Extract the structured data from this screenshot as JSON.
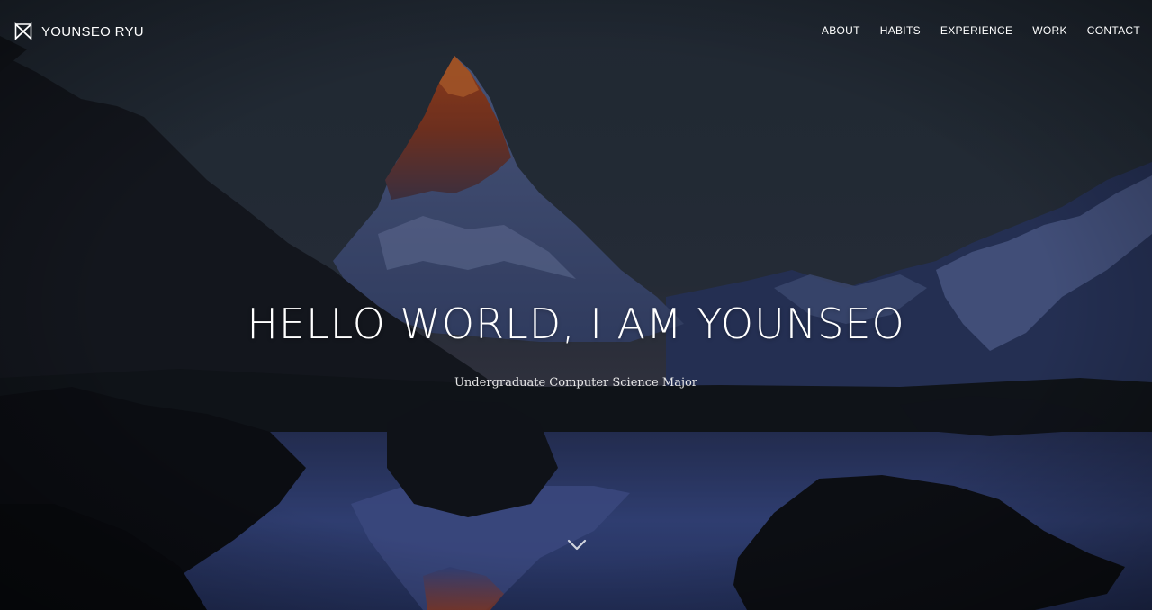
{
  "brand": {
    "name": "YOUNSEO RYU",
    "icon": "bowtie-logo-icon"
  },
  "nav": {
    "items": [
      {
        "label": "ABOUT"
      },
      {
        "label": "HABITS"
      },
      {
        "label": "EXPERIENCE"
      },
      {
        "label": "WORK"
      },
      {
        "label": "CONTACT"
      }
    ]
  },
  "hero": {
    "headline": "HELLO WORLD, I AM YOUNSEO",
    "subtitle": "Undergraduate Computer Science Major",
    "scroll_icon": "chevron-down-icon",
    "background": "mountain-lake-night-photo"
  },
  "colors": {
    "text": "#ffffff",
    "sky_top": "#27313b",
    "peak_glow": "#c8581f",
    "lake": "#3a4c8a"
  }
}
